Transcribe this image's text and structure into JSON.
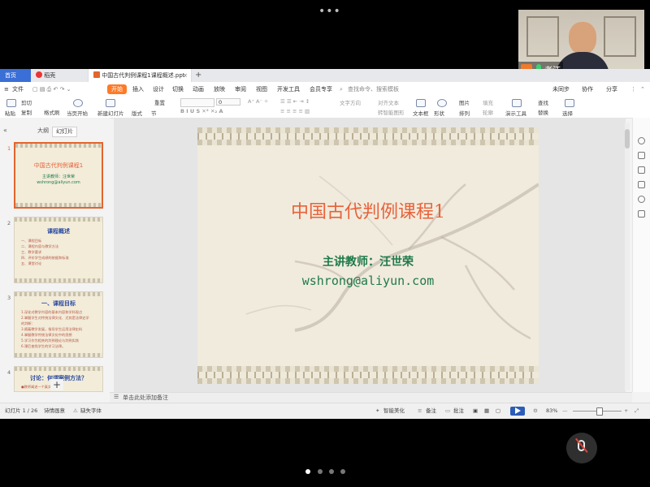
{
  "tabs": {
    "home": "首页",
    "wps": "稻壳",
    "document": "中国古代判例课程1课程概述.ppt",
    "add": "+"
  },
  "menubar": {
    "file": "文件",
    "items": [
      "开始",
      "插入",
      "设计",
      "切换",
      "动画",
      "放映",
      "审阅",
      "视图",
      "开发工具",
      "会员专享"
    ],
    "search_placeholder": "查找命令、搜索模板",
    "right": [
      "未同步",
      "协作",
      "分享"
    ]
  },
  "ribbon": {
    "paste": "粘贴",
    "cut": "剪切",
    "copy": "复制",
    "format_painter": "格式刷",
    "play_from_current": "当页开始",
    "new_slide": "新建幻灯片",
    "layout": "版式",
    "section": "节",
    "reset": "重置",
    "font_size": "0",
    "text_direction": "文字方向",
    "align_text": "对齐文本",
    "smart_art": "转智能图形",
    "textbox": "文本框",
    "shape": "形状",
    "arrange": "排列",
    "picture": "图片",
    "fill": "填充",
    "outline": "轮廓",
    "presenter": "演示工具",
    "find": "查找",
    "replace": "替换",
    "select": "选择"
  },
  "leftpanel": {
    "outline_tab": "大纲",
    "slides_tab": "幻灯片",
    "thumbnails": [
      {
        "num": "1",
        "title": "中国古代判例课程1",
        "lines": [
          "主讲教师：汪世荣",
          "wshrong@aliyun.com"
        ]
      },
      {
        "num": "2",
        "title": "课程概述",
        "lines": [
          "一、课程目标",
          "二、课程内容与教学方法",
          "三、教学要求",
          "四、评价学生成绩的依据和标准",
          "五、课堂讨论"
        ]
      },
      {
        "num": "3",
        "title": "一、课程目标",
        "lines": [
          "1.深化对教学内容的基本内容和学科观点",
          "2.掌握学生对传统法律文化、尤其是法律史学",
          "的判断：",
          "3.随着教学发展，指导学生运用法律史料",
          "4.掌握教学传统法律文化中的思想",
          "5.学习作为相关的判例理论与判例实践",
          "6.课后查找学生的学习法律。"
        ]
      },
      {
        "num": "4",
        "title": "讨论：何谓案例方法？",
        "lines": [
          "●教师阐述一个真实的案例"
        ]
      }
    ]
  },
  "slide": {
    "title": "中国古代判例课程1",
    "teacher": "主讲教师：汪世荣",
    "email": "wshrong@aliyun.com"
  },
  "notes_placeholder": "单击此处添加备注",
  "statusbar": {
    "slide_counter": "幻灯片 1 / 26",
    "theme": "诗情画意",
    "missing_font": "缺失字体",
    "smart_beautify": "智能美化",
    "notes": "备注",
    "comments": "批注",
    "zoom": "83%"
  },
  "webcam": {
    "name": "老汪"
  },
  "colors": {
    "accent_orange": "#ff7a26",
    "home_tab_blue": "#3a6fd8",
    "slide_title": "#e8623a",
    "slide_green": "#1f7a4a"
  }
}
